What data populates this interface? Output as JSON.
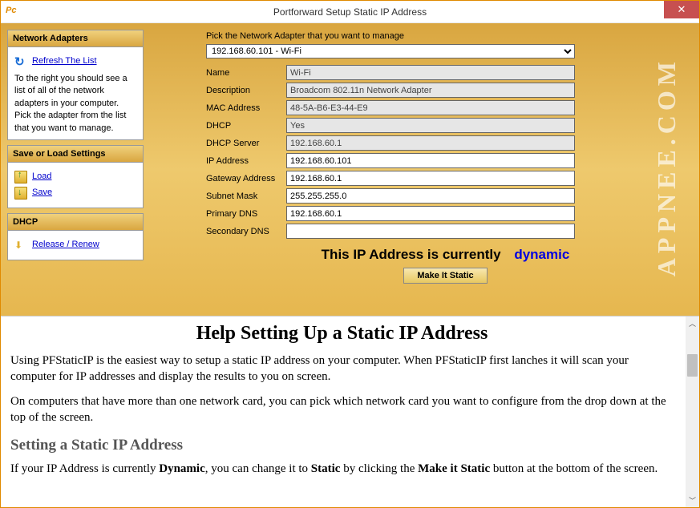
{
  "window": {
    "title": "Portforward Setup Static IP Address",
    "close_label": "✕"
  },
  "sidebar": {
    "adapters": {
      "header": "Network Adapters",
      "refresh_link": "Refresh The List",
      "text": "To the right you should see a list of all of the network adapters in your computer. Pick the adapter from the list that you want to manage."
    },
    "settings": {
      "header": "Save or Load Settings",
      "load_link": "Load",
      "save_link": "Save"
    },
    "dhcp": {
      "header": "DHCP",
      "release_link": "Release / Renew"
    }
  },
  "content": {
    "prompt": "Pick the Network Adapter that you want to manage",
    "adapter_selected": "192.168.60.101 - Wi-Fi",
    "fields": {
      "name": {
        "label": "Name",
        "value": "Wi-Fi"
      },
      "description": {
        "label": "Description",
        "value": "Broadcom 802.11n Network Adapter"
      },
      "mac": {
        "label": "MAC Address",
        "value": "48-5A-B6-E3-44-E9"
      },
      "dhcp": {
        "label": "DHCP",
        "value": "Yes"
      },
      "dhcp_server": {
        "label": "DHCP Server",
        "value": "192.168.60.1"
      },
      "ip": {
        "label": "IP Address",
        "value": "192.168.60.101"
      },
      "gateway": {
        "label": "Gateway Address",
        "value": "192.168.60.1"
      },
      "subnet": {
        "label": "Subnet Mask",
        "value": "255.255.255.0"
      },
      "dns1": {
        "label": "Primary DNS",
        "value": "192.168.60.1"
      },
      "dns2": {
        "label": "Secondary DNS",
        "value": ""
      }
    },
    "status_prefix": "This IP Address is currently",
    "status_value": "dynamic",
    "make_static_label": "Make It Static"
  },
  "watermark": "APPNEE.COM",
  "help": {
    "h1": "Help Setting Up a Static IP Address",
    "p1": "Using PFStaticIP is the easiest way to setup a static IP address on your computer. When PFStaticIP first lanches it will scan your computer for IP addresses and display the results to you on screen.",
    "p2": "On computers that have more than one network card, you can pick which network card you want to configure from the drop down at the top of the screen.",
    "h2": "Setting a Static IP Address",
    "p3a": "If your IP Address is currently ",
    "p3b": "Dynamic",
    "p3c": ", you can change it to ",
    "p3d": "Static",
    "p3e": " by clicking the ",
    "p3f": "Make it Static",
    "p3g": " button at the bottom of the screen."
  }
}
